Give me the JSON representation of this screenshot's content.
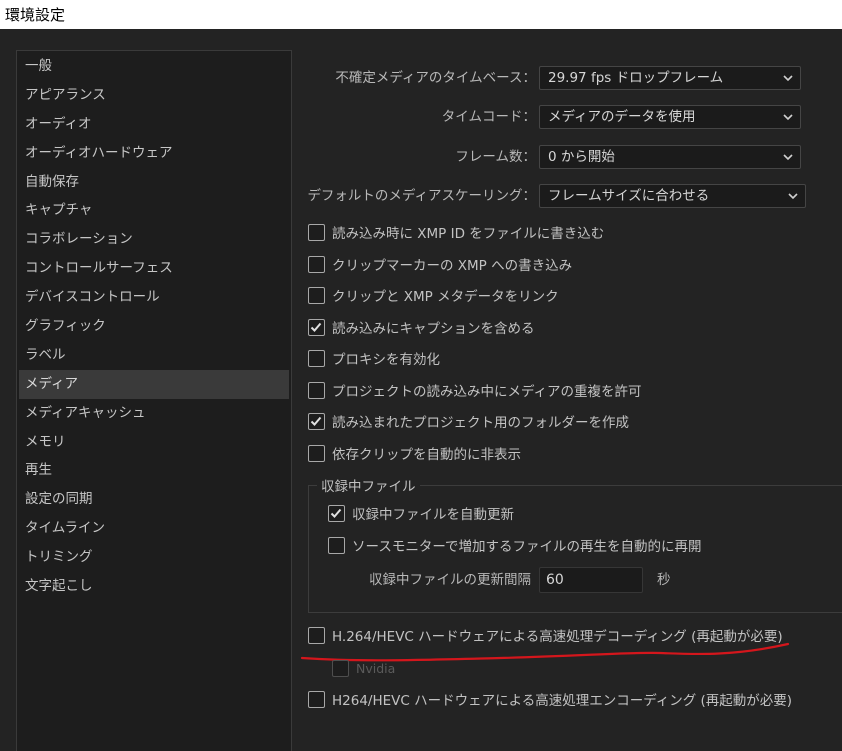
{
  "window": {
    "title": "環境設定"
  },
  "sidebar": {
    "items": [
      "一般",
      "アピアランス",
      "オーディオ",
      "オーディオハードウェア",
      "自動保存",
      "キャプチャ",
      "コラボレーション",
      "コントロールサーフェス",
      "デバイスコントロール",
      "グラフィック",
      "ラベル",
      "メディア",
      "メディアキャッシュ",
      "メモリ",
      "再生",
      "設定の同期",
      "タイムライン",
      "トリミング",
      "文字起こし"
    ],
    "active": "メディア"
  },
  "media": {
    "timebase": {
      "label": "不確定メディアのタイムベース：",
      "value": "29.97 fps ドロップフレーム"
    },
    "timecode": {
      "label": "タイムコード：",
      "value": "メディアのデータを使用"
    },
    "frame_number": {
      "label": "フレーム数：",
      "value": "0 から開始"
    },
    "default_scaling": {
      "label": "デフォルトのメディアスケーリング：",
      "value": "フレームサイズに合わせる"
    },
    "checkboxes": [
      {
        "label": "読み込み時に XMP ID をファイルに書き込む",
        "checked": false
      },
      {
        "label": "クリップマーカーの XMP への書き込み",
        "checked": false
      },
      {
        "label": "クリップと XMP メタデータをリンク",
        "checked": false
      },
      {
        "label": "読み込みにキャプションを含める",
        "checked": true
      },
      {
        "label": "プロキシを有効化",
        "checked": false
      },
      {
        "label": "プロジェクトの読み込み中にメディアの重複を許可",
        "checked": false
      },
      {
        "label": "読み込まれたプロジェクト用のフォルダーを作成",
        "checked": true
      },
      {
        "label": "依存クリップを自動的に非表示",
        "checked": false
      }
    ],
    "growing_files": {
      "title": "収録中ファイル",
      "auto_refresh": {
        "label": "収録中ファイルを自動更新",
        "checked": true
      },
      "resume_playback": {
        "label": "ソースモニターで増加するファイルの再生を自動的に再開",
        "checked": false
      },
      "refresh_interval": {
        "label": "収録中ファイルの更新間隔",
        "value": "60",
        "unit": "秒"
      }
    },
    "hw_decoding": {
      "label": "H.264/HEVC ハードウェアによる高速処理デコーディング (再起動が必要)",
      "checked": false
    },
    "nvidia": {
      "label": "Nvidia",
      "checked": false,
      "enabled": false
    },
    "hw_encoding": {
      "label": "H264/HEVC ハードウェアによる高速処理エンコーディング (再起動が必要)",
      "checked": false
    }
  },
  "annotation_color": "#d4161c"
}
